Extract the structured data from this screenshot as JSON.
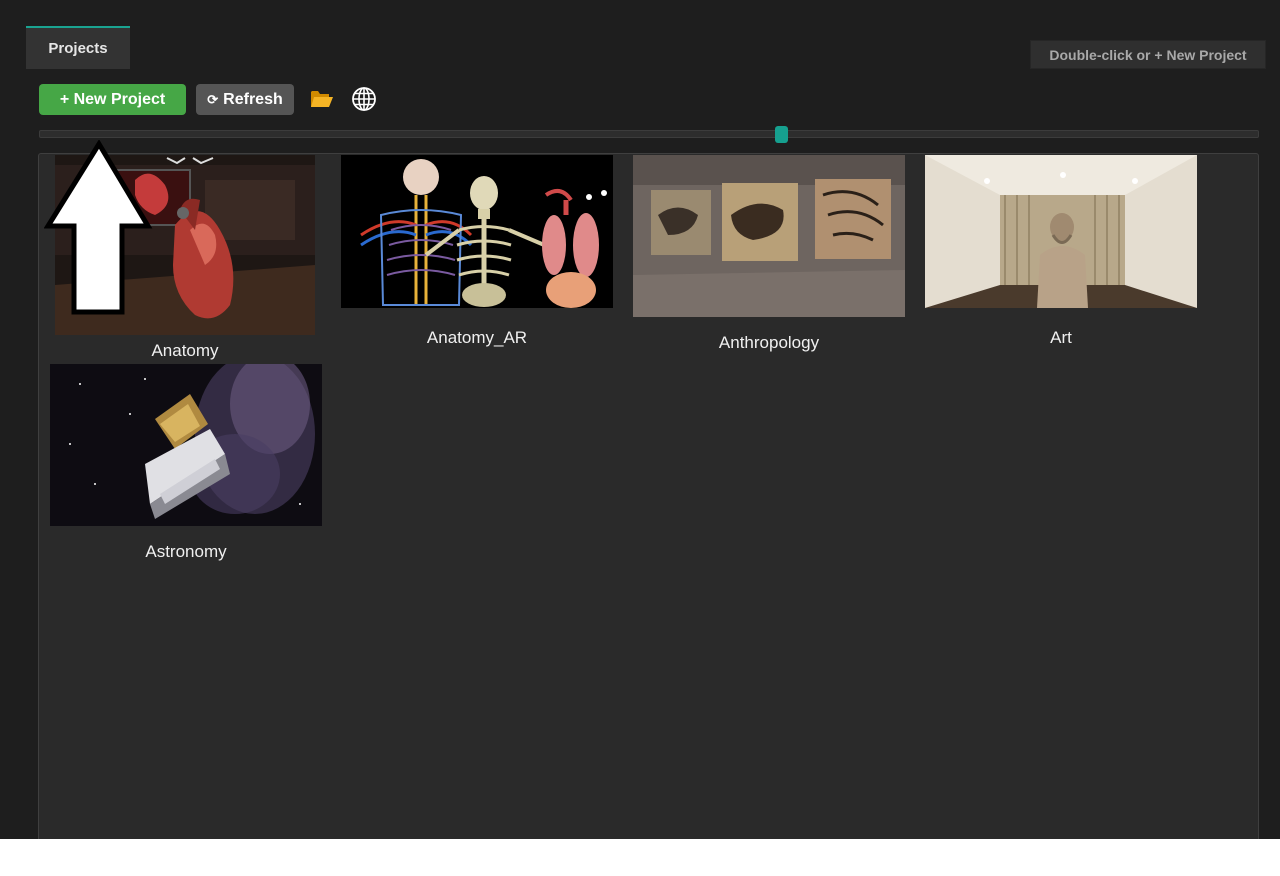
{
  "tab": {
    "label": "Projects"
  },
  "hint": {
    "label": "Double-click or + New Project"
  },
  "toolbar": {
    "new_project_label": "+ New Project",
    "refresh_icon": "⟳",
    "refresh_label": "Refresh",
    "folder_icon": "folder-icon",
    "globe_icon": "globe-icon"
  },
  "zoom_slider": {
    "value_fraction": 0.61
  },
  "projects": [
    {
      "name": "Anatomy"
    },
    {
      "name": "Anatomy_AR"
    },
    {
      "name": "Anthropology"
    },
    {
      "name": "Art"
    },
    {
      "name": "Astronomy"
    }
  ],
  "colors": {
    "accent": "#16a08f",
    "new_button": "#46a746",
    "refresh_button": "#555555",
    "background": "#1e1e1e",
    "panel": "#2a2a2a"
  }
}
